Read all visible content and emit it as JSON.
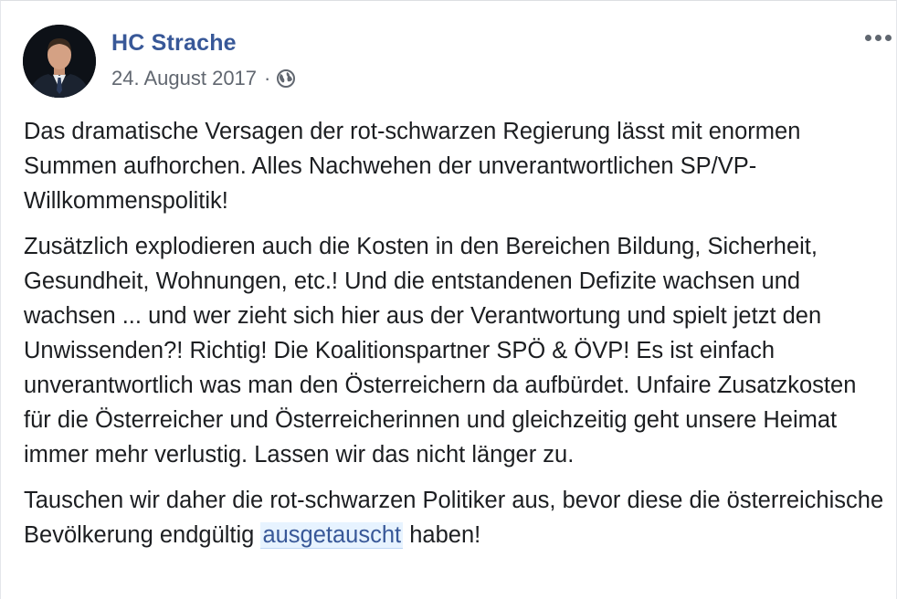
{
  "post": {
    "author": "HC Strache",
    "date": "24. August 2017",
    "separator": "·",
    "privacy_icon": "globe-icon",
    "menu_icon": "more-options-icon",
    "paragraphs": {
      "p1": "Das dramatische Versagen der rot-schwarzen Regierung lässt mit enormen Summen aufhorchen. Alles Nachwehen der unverantwortlichen SP/VP-Willkommenspolitik!",
      "p2": "Zusätzlich explodieren auch die Kosten in den Bereichen Bildung, Sicherheit, Gesundheit, Wohnungen, etc.! Und die entstandenen Defizite wachsen und wachsen ... und wer zieht sich hier aus der Verantwortung und spielt jetzt den Unwissenden?! Richtig! Die Koalitionspartner SPÖ & ÖVP! Es ist einfach unverantwortlich was man den Österreichern da aufbürdet. Unfaire Zusatzkosten für die Österreicher und Österreicherinnen und gleichzeitig geht unsere Heimat immer mehr verlustig. Lassen wir das nicht länger zu.",
      "p3_before": "Tauschen wir daher die rot-schwarzen Politiker aus, bevor diese die österreichische Bevölkerung endgültig ",
      "p3_highlight": "ausgetauscht",
      "p3_after": " haben!"
    }
  },
  "colors": {
    "author": "#385898",
    "meta": "#616770",
    "text": "#1c1e21",
    "highlight_bg": "#e7f3ff"
  }
}
